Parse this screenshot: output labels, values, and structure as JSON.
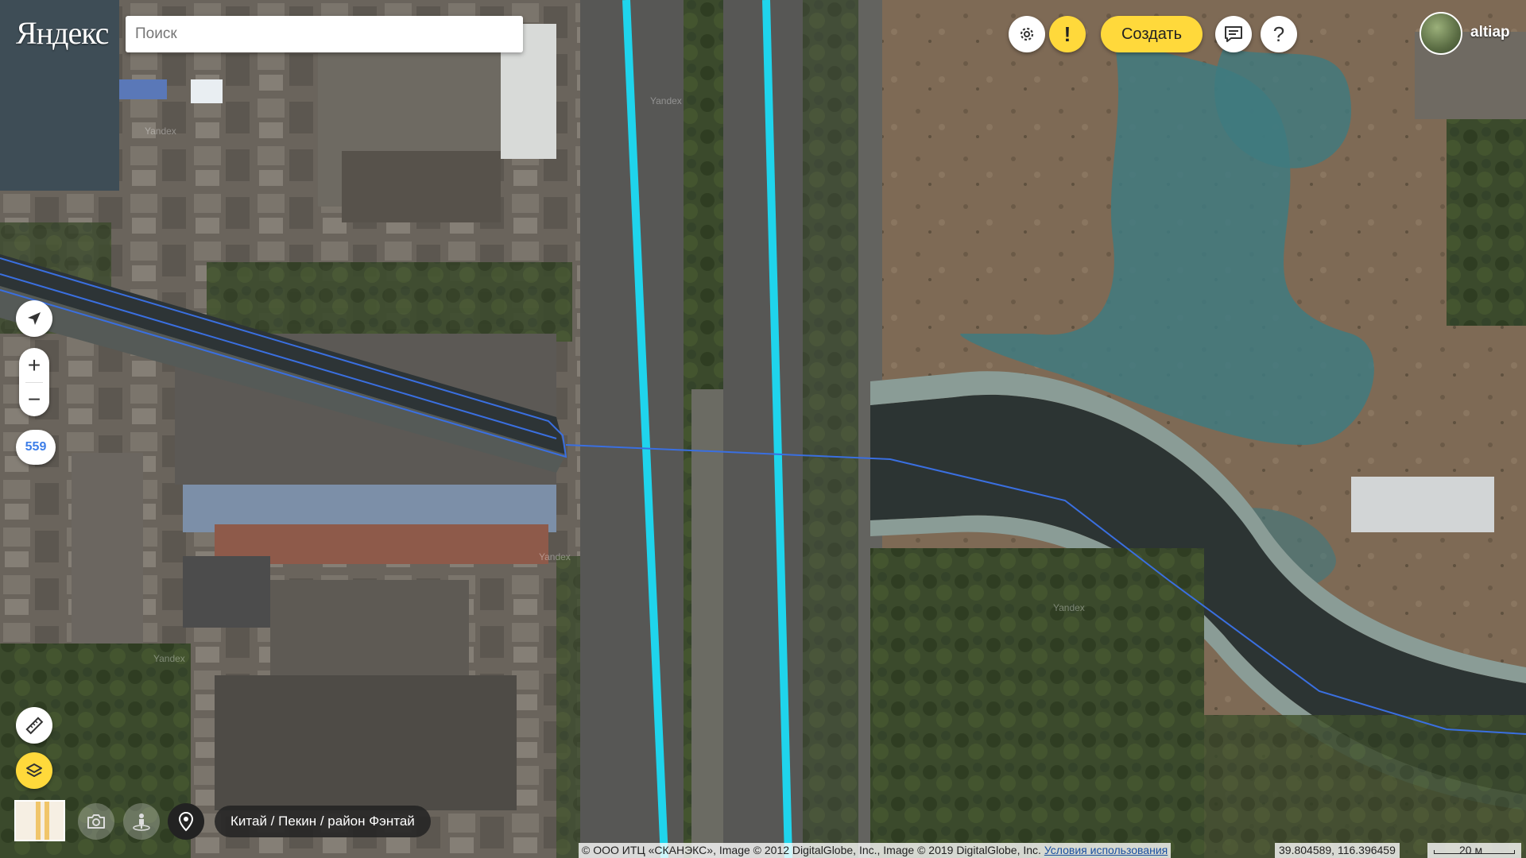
{
  "brand": {
    "logo_text": "Яндекс"
  },
  "search": {
    "placeholder": "Поиск"
  },
  "header": {
    "create_label": "Создать",
    "username": "altiap",
    "warning_symbol": "!",
    "help_symbol": "?"
  },
  "map_controls": {
    "zoom_in": "+",
    "zoom_out": "−",
    "counter_badge": "559"
  },
  "breadcrumb": {
    "text": "Китай / Пекин / район Фэнтай"
  },
  "footer": {
    "copyright": "© ООО ИТЦ «СКАНЭКС», Image © 2012 DigitalGlobe, Inc., Image © 2019 DigitalGlobe, Inc.",
    "terms_link": "Условия использования",
    "coordinates": "39.804589, 116.396459",
    "scale_label": "20 м"
  },
  "watermark": "Yandex",
  "colors": {
    "accent_yellow": "#ffd93b",
    "road_highlight": "#1fd4ec",
    "waterway_line": "#3a6fe0",
    "link_blue": "#1a4fa0"
  },
  "icons": {
    "settings": "gear-icon",
    "warning": "exclamation-icon",
    "feedback": "chat-icon",
    "help": "question-icon",
    "geolocation": "arrow-location-icon",
    "ruler": "ruler-icon",
    "layers": "layers-icon",
    "camera": "camera-icon",
    "panorama": "person-panorama-icon",
    "placemark": "pin-icon"
  }
}
